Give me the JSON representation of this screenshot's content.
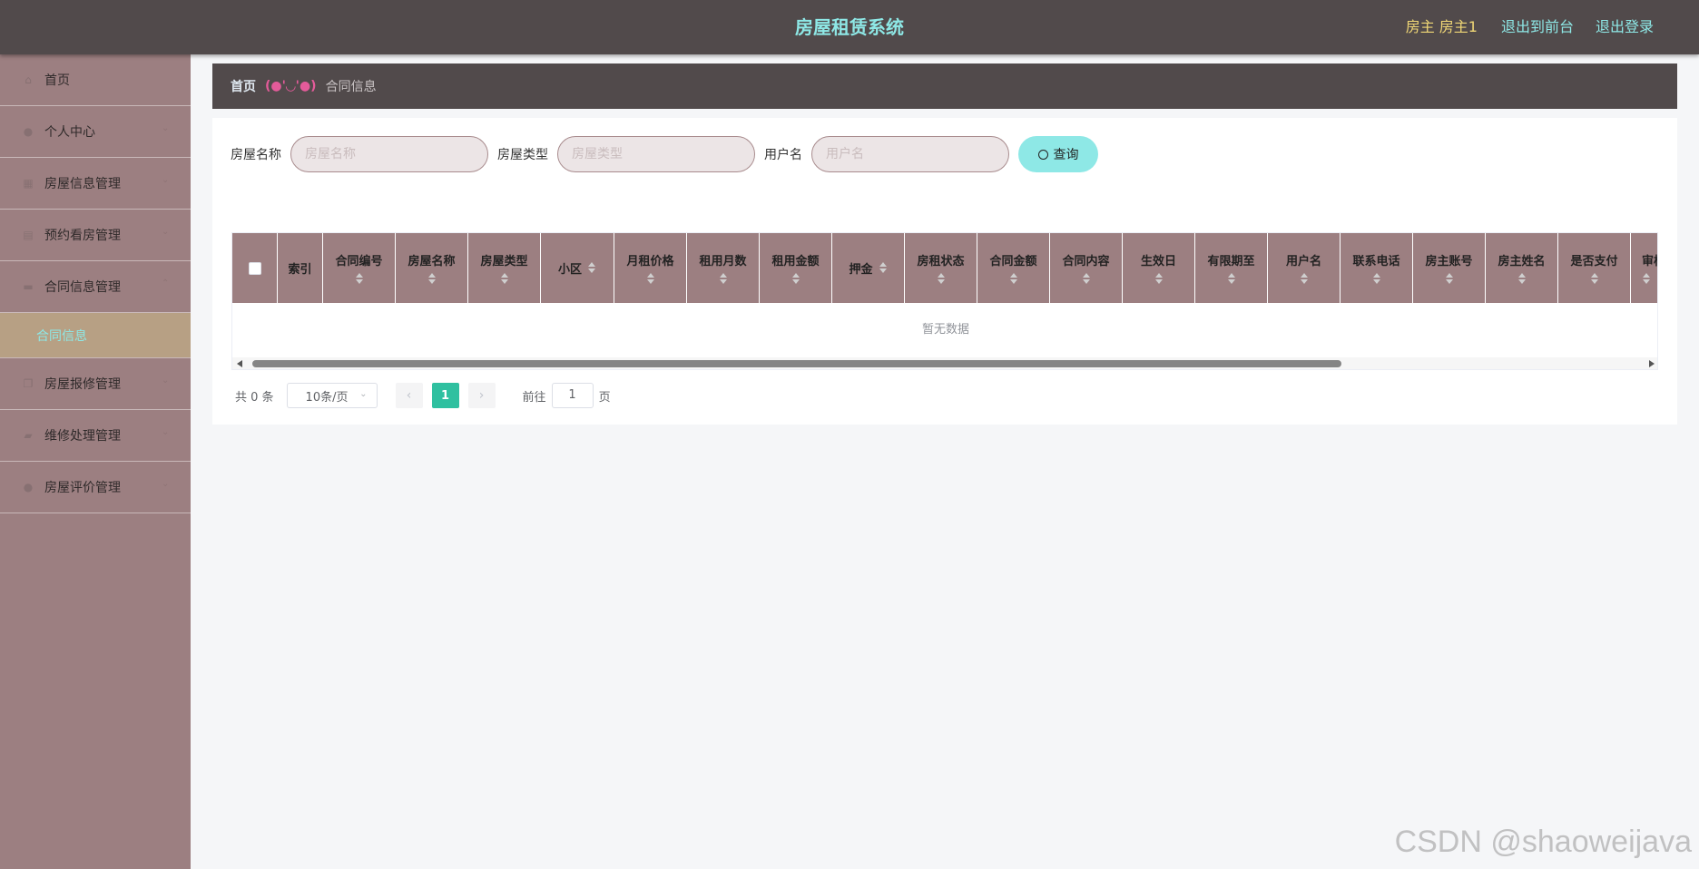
{
  "header": {
    "title": "房屋租赁系统",
    "user": "房主 房主1",
    "to_front": "退出到前台",
    "logout": "退出登录"
  },
  "sidebar": {
    "items": [
      {
        "label": "首页",
        "icon": "home-icon"
      },
      {
        "label": "个人中心",
        "icon": "user-icon"
      },
      {
        "label": "房屋信息管理",
        "icon": "grid-icon"
      },
      {
        "label": "预约看房管理",
        "icon": "calendar-icon"
      },
      {
        "label": "合同信息管理",
        "icon": "card-icon"
      },
      {
        "label": "房屋报修管理",
        "icon": "copy-icon"
      },
      {
        "label": "维修处理管理",
        "icon": "briefcase-icon"
      },
      {
        "label": "房屋评价管理",
        "icon": "person-icon"
      }
    ],
    "active_sub": "合同信息"
  },
  "breadcrumb": {
    "home": "首页",
    "separator": "(●'◡'●)",
    "current": "合同信息"
  },
  "search": {
    "house_name_label": "房屋名称",
    "house_name_placeholder": "房屋名称",
    "house_type_label": "房屋类型",
    "house_type_placeholder": "房屋类型",
    "username_label": "用户名",
    "username_placeholder": "用户名",
    "button": "查询"
  },
  "table": {
    "columns": [
      "索引",
      "合同编号",
      "房屋名称",
      "房屋类型",
      "小区",
      "月租价格",
      "租用月数",
      "租用金额",
      "押金",
      "房租状态",
      "合同金额",
      "合同内容",
      "生效日",
      "有限期至",
      "用户名",
      "联系电话",
      "房主账号",
      "房主姓名",
      "是否支付",
      "审核"
    ],
    "empty_text": "暂无数据"
  },
  "pagination": {
    "total": "共 0 条",
    "page_size": "10条/页",
    "current_page": "1",
    "goto_label": "前往",
    "goto_value": "1",
    "page_suffix": "页"
  },
  "watermark": "CSDN @shaoweijava",
  "colors": {
    "topbar": "#514a4b",
    "sidebar": "#9c7f81",
    "accent": "#8ee8e6",
    "active_sub": "#b7a084",
    "pager_active": "#2fc0a0"
  }
}
